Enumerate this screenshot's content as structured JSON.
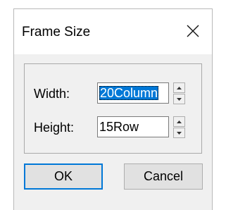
{
  "dialog": {
    "title": "Frame Size",
    "close_icon": "close-icon",
    "width_label": "Width:",
    "width_value": "20Column",
    "height_label": "Height:",
    "height_value": "15Row",
    "ok_label": "OK",
    "cancel_label": "Cancel"
  },
  "colors": {
    "selection": "#0078d7",
    "dialog_bg": "#f0f0f0",
    "titlebar_bg": "#ffffff"
  }
}
